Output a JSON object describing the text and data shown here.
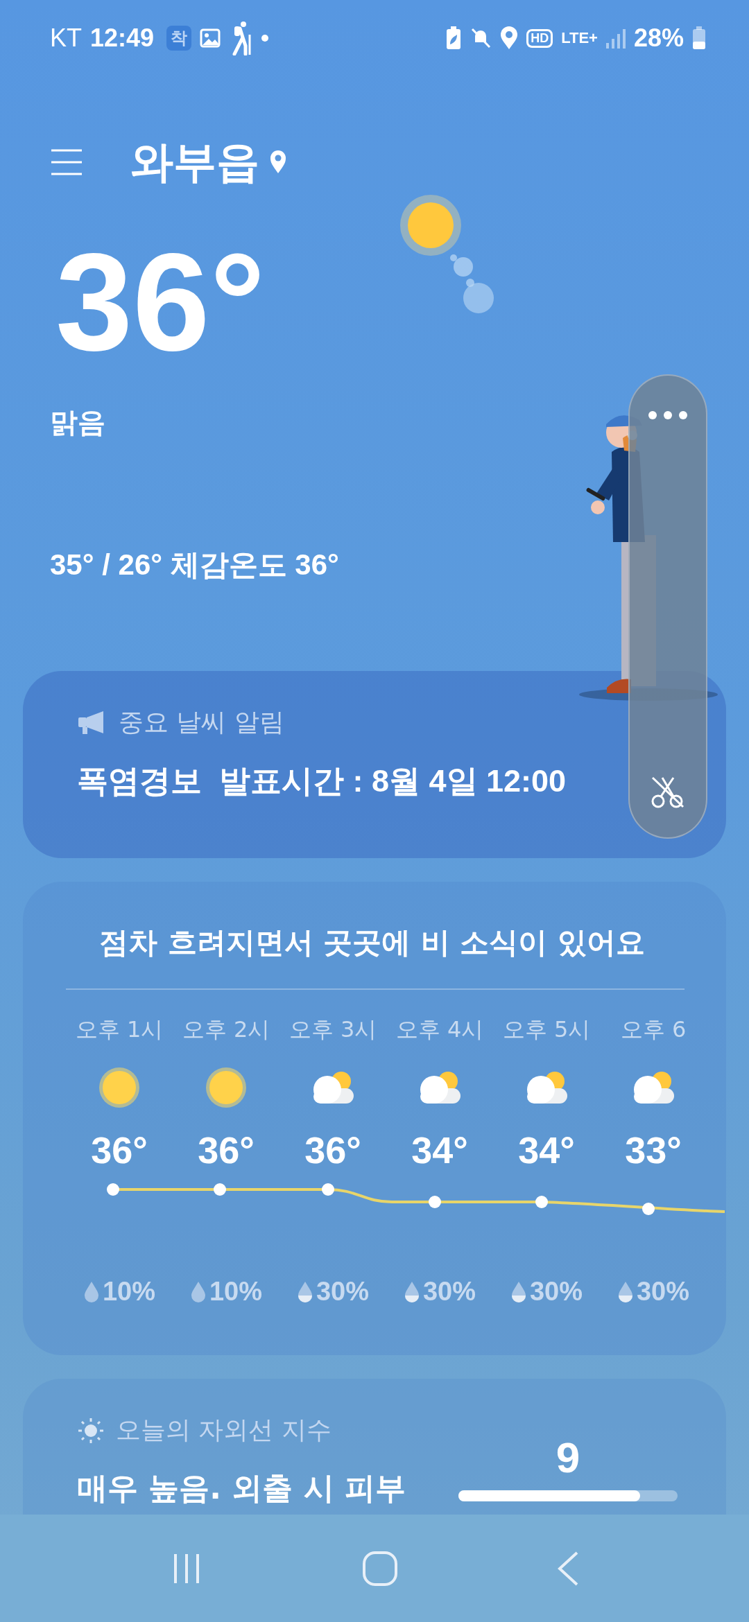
{
  "status_bar": {
    "carrier": "KT",
    "time": "12:49",
    "app_badge": "착",
    "hd": "HD",
    "network": "LTE+",
    "battery": "28%"
  },
  "header": {
    "location": "와부읍"
  },
  "current": {
    "temperature": "36°",
    "condition": "맑음",
    "range": "35° / 26° 체감온도 36°"
  },
  "alert": {
    "label": "중요 날씨 알림",
    "text": "폭염경보  발표시간 : 8월 4일 12:00"
  },
  "hourly": {
    "summary": "점차 흐려지면서 곳곳에 비 소식이 있어요",
    "hours": [
      {
        "time": "오후 1시",
        "kind": "sunny",
        "temp": "36°",
        "precip": "10%"
      },
      {
        "time": "오후 2시",
        "kind": "sunny",
        "temp": "36°",
        "precip": "10%"
      },
      {
        "time": "오후 3시",
        "kind": "partly-cloudy",
        "temp": "36°",
        "precip": "30%"
      },
      {
        "time": "오후 4시",
        "kind": "partly-cloudy",
        "temp": "34°",
        "precip": "30%"
      },
      {
        "time": "오후 5시",
        "kind": "partly-cloudy",
        "temp": "34°",
        "precip": "30%"
      },
      {
        "time": "오후 6",
        "kind": "partly-cloudy",
        "temp": "33°",
        "precip": "30%"
      }
    ]
  },
  "uv": {
    "label": "오늘의 자외선 지수",
    "text": "매우 높음. 외출 시 피부",
    "value": "9",
    "level": 0.83
  }
}
